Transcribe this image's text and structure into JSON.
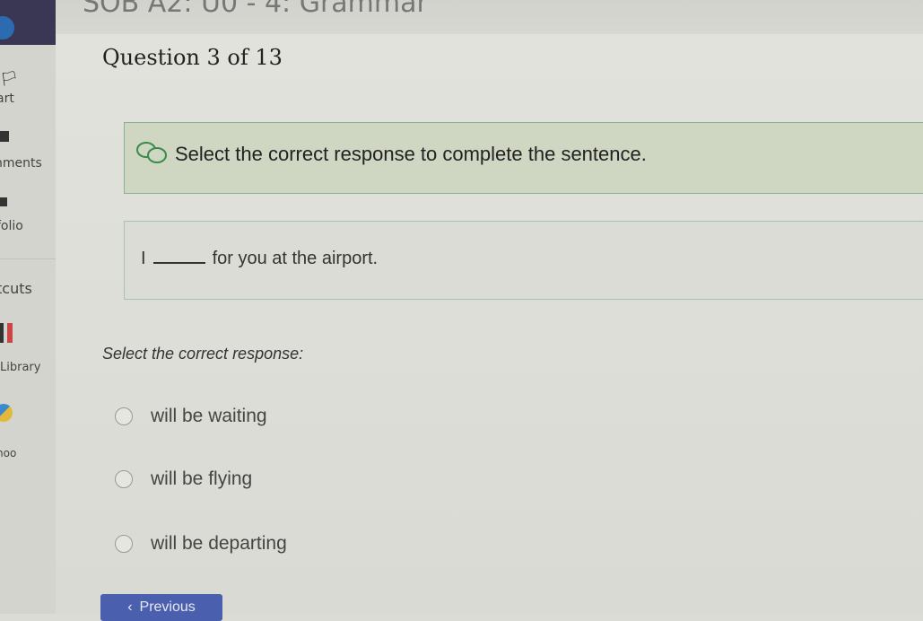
{
  "header": {
    "breadcrumb": "SOB A2: U0 - 4: Grammar"
  },
  "sidebar": {
    "items": [
      {
        "label": "art",
        "icon": "flag-icon"
      },
      {
        "label": "nments",
        "icon": "assignments-icon"
      },
      {
        "label": "folio",
        "icon": "portfolio-icon"
      },
      {
        "label": "tcuts",
        "icon": ""
      },
      {
        "label": "Library",
        "icon": "library-icon"
      },
      {
        "label": "noo",
        "icon": "globe-icon"
      }
    ]
  },
  "question": {
    "counter": "Question 3 of 13",
    "prompt": "Select the correct response to complete the sentence.",
    "sentence_before": "I",
    "sentence_after": "for you at the airport.",
    "instruction": "Select the correct response:",
    "options": [
      "will be waiting",
      "will be flying",
      "will be departing"
    ]
  },
  "nav": {
    "previous_label": "Previous"
  },
  "colors": {
    "accent": "#4a5fae",
    "prompt_bg": "#cfd6c2",
    "prompt_border": "#88b48a"
  }
}
